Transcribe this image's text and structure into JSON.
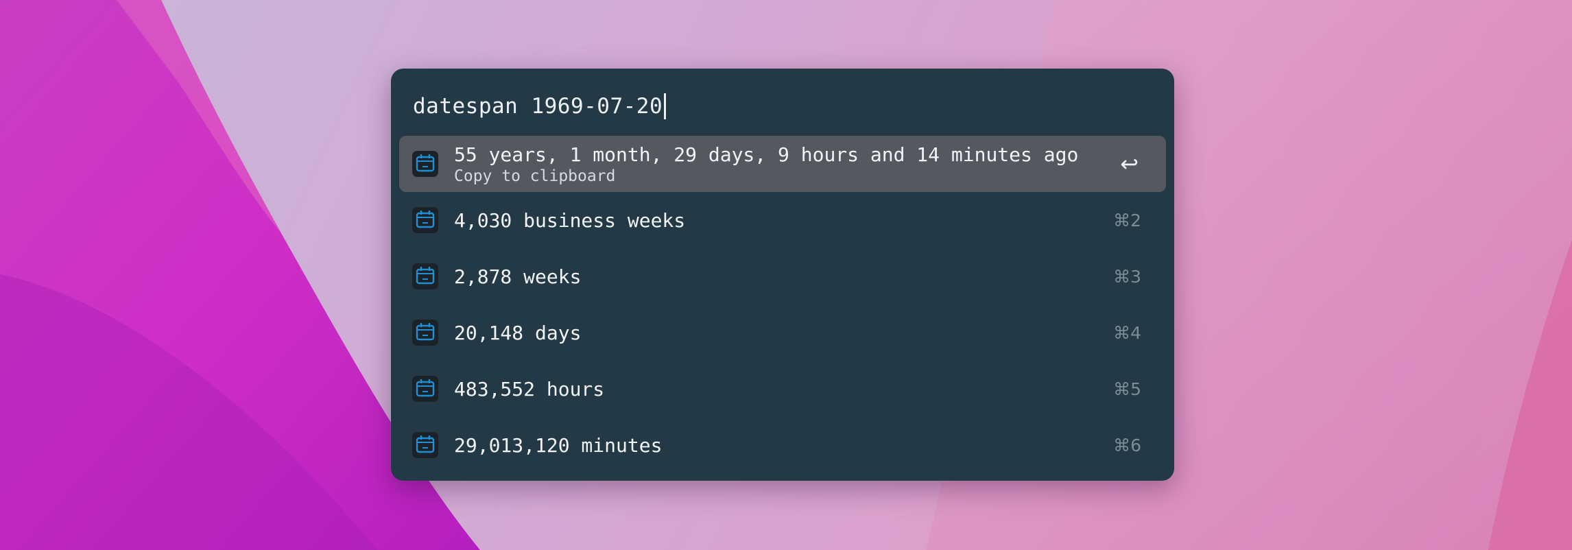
{
  "query": "datespan 1969-07-20",
  "results": [
    {
      "title": "55 years, 1 month, 29 days, 9 hours and 14 minutes ago",
      "subtitle": "Copy to clipboard",
      "shortcut": "↩",
      "icon": "calendar-icon",
      "selected": true
    },
    {
      "title": "4,030 business weeks",
      "shortcut": "⌘2",
      "icon": "calendar-icon"
    },
    {
      "title": "2,878 weeks",
      "shortcut": "⌘3",
      "icon": "calendar-icon"
    },
    {
      "title": "20,148 days",
      "shortcut": "⌘4",
      "icon": "calendar-icon"
    },
    {
      "title": "483,552 hours",
      "shortcut": "⌘5",
      "icon": "calendar-icon"
    },
    {
      "title": "29,013,120 minutes",
      "shortcut": "⌘6",
      "icon": "calendar-icon"
    }
  ],
  "colors": {
    "panel": "#233946",
    "selected_row": "#565861",
    "icon_accent": "#1f8fd6",
    "wallpaper_magenta": "#c92fc4",
    "wallpaper_pink": "#de8fbf"
  }
}
